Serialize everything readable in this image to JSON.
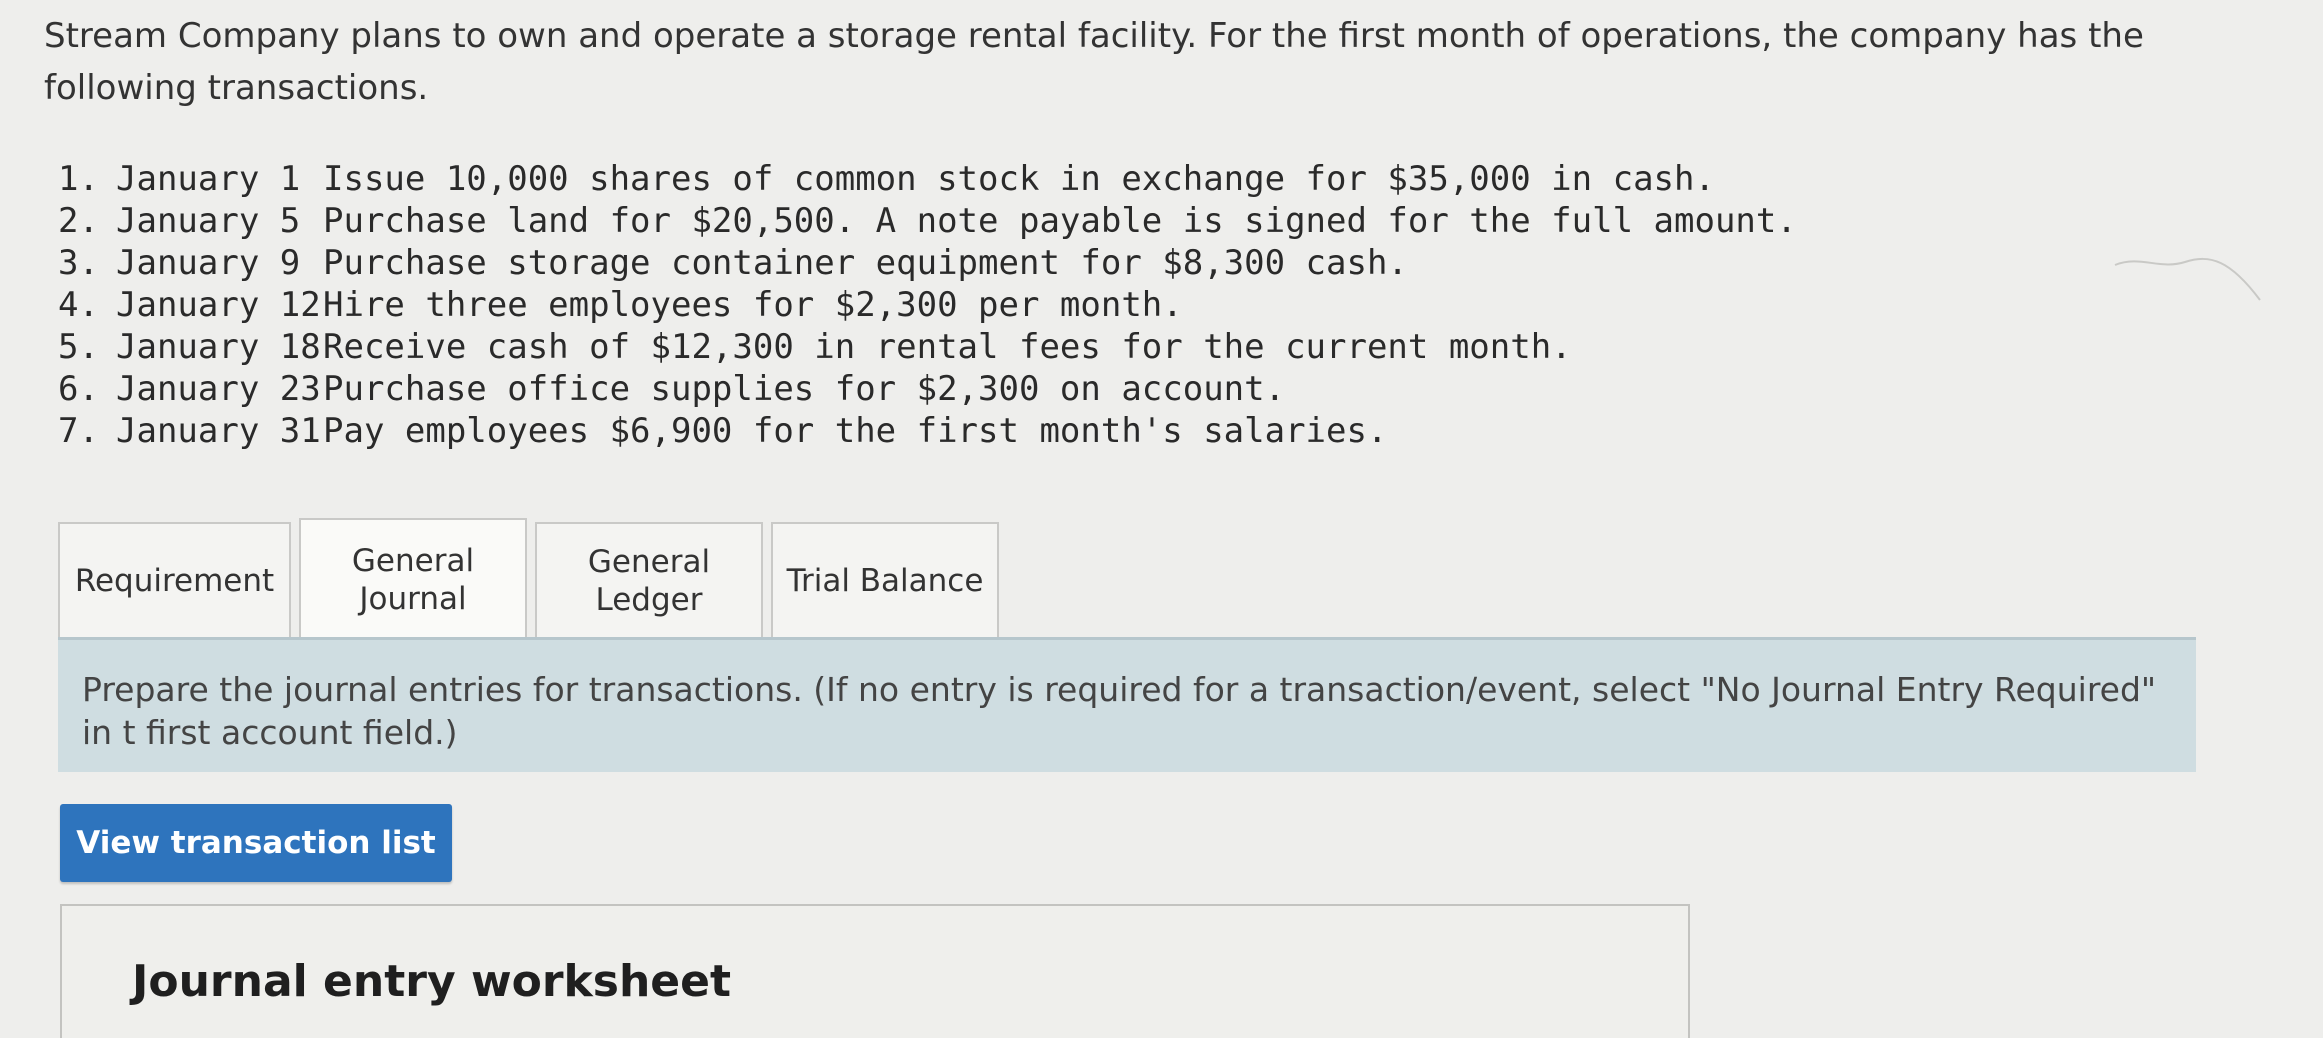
{
  "intro": "Stream Company plans to own and operate a storage rental facility. For the first month of operations, the company has the following transactions.",
  "transactions": [
    {
      "num": "1.",
      "date": "January 1",
      "text": "Issue 10,000 shares of common stock in exchange for $35,000 in cash."
    },
    {
      "num": "2.",
      "date": "January 5",
      "text": "Purchase land for $20,500. A note payable is signed for the full amount."
    },
    {
      "num": "3.",
      "date": "January 9",
      "text": "Purchase storage container equipment for $8,300 cash."
    },
    {
      "num": "4.",
      "date": "January 12",
      "text": "Hire three employees for $2,300 per month."
    },
    {
      "num": "5.",
      "date": "January 18",
      "text": "Receive cash of $12,300 in rental fees for the current month."
    },
    {
      "num": "6.",
      "date": "January 23",
      "text": "Purchase office supplies for $2,300 on account."
    },
    {
      "num": "7.",
      "date": "January 31",
      "text": "Pay employees $6,900 for the first month's salaries."
    }
  ],
  "tabs": [
    {
      "label": "Requirement"
    },
    {
      "label_line1": "General",
      "label_line2": "Journal",
      "active": true
    },
    {
      "label_line1": "General",
      "label_line2": "Ledger"
    },
    {
      "label": "Trial Balance"
    }
  ],
  "instruction": "Prepare the journal entries for transactions. (If no entry is required for a transaction/event, select \"No Journal Entry Required\" in t first account field.)",
  "view_button_label": "View transaction list",
  "worksheet_title": "Journal entry worksheet",
  "colors": {
    "accent": "#2e74bd",
    "instruction_bg": "#cfdde1",
    "page_bg": "#eeeeec"
  }
}
